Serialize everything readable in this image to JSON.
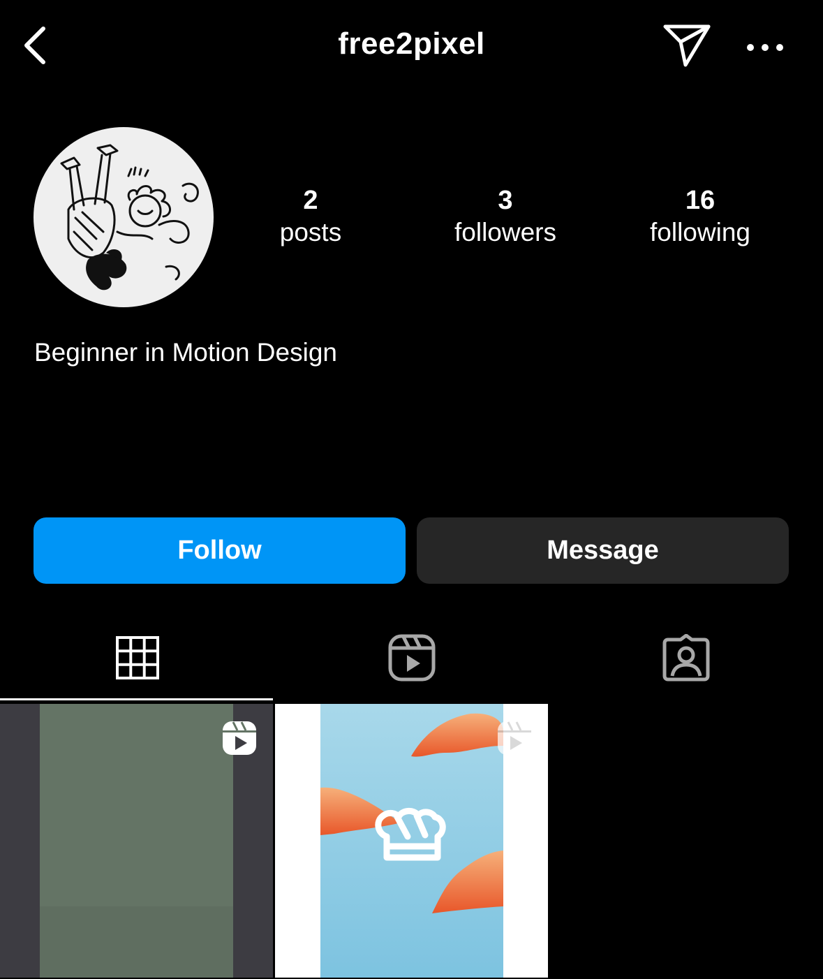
{
  "header": {
    "username": "free2pixel",
    "back_icon": "chevron-left-icon",
    "direct_icon": "paper-plane-icon",
    "more_icon": "more-horizontal-icon"
  },
  "profile": {
    "avatar_icon": "illustrated-avatar",
    "stats": [
      {
        "value": "2",
        "label": "posts"
      },
      {
        "value": "3",
        "label": "followers"
      },
      {
        "value": "16",
        "label": "following"
      }
    ],
    "bio": "Beginner in Motion Design"
  },
  "actions": {
    "follow_label": "Follow",
    "message_label": "Message",
    "follow_color": "#0095f6",
    "message_color": "#262626"
  },
  "tabs": [
    {
      "name": "grid",
      "icon": "grid-icon",
      "active": true
    },
    {
      "name": "reels",
      "icon": "reels-icon",
      "active": false
    },
    {
      "name": "tagged",
      "icon": "tagged-person-icon",
      "active": false
    }
  ],
  "posts": [
    {
      "type": "reel",
      "icon": "reel-badge-icon",
      "colors": [
        "#3d3c42",
        "#647465"
      ]
    },
    {
      "type": "reel",
      "icon": "reel-badge-icon",
      "colors": [
        "#a8d8ea",
        "#e8572a"
      ]
    }
  ]
}
